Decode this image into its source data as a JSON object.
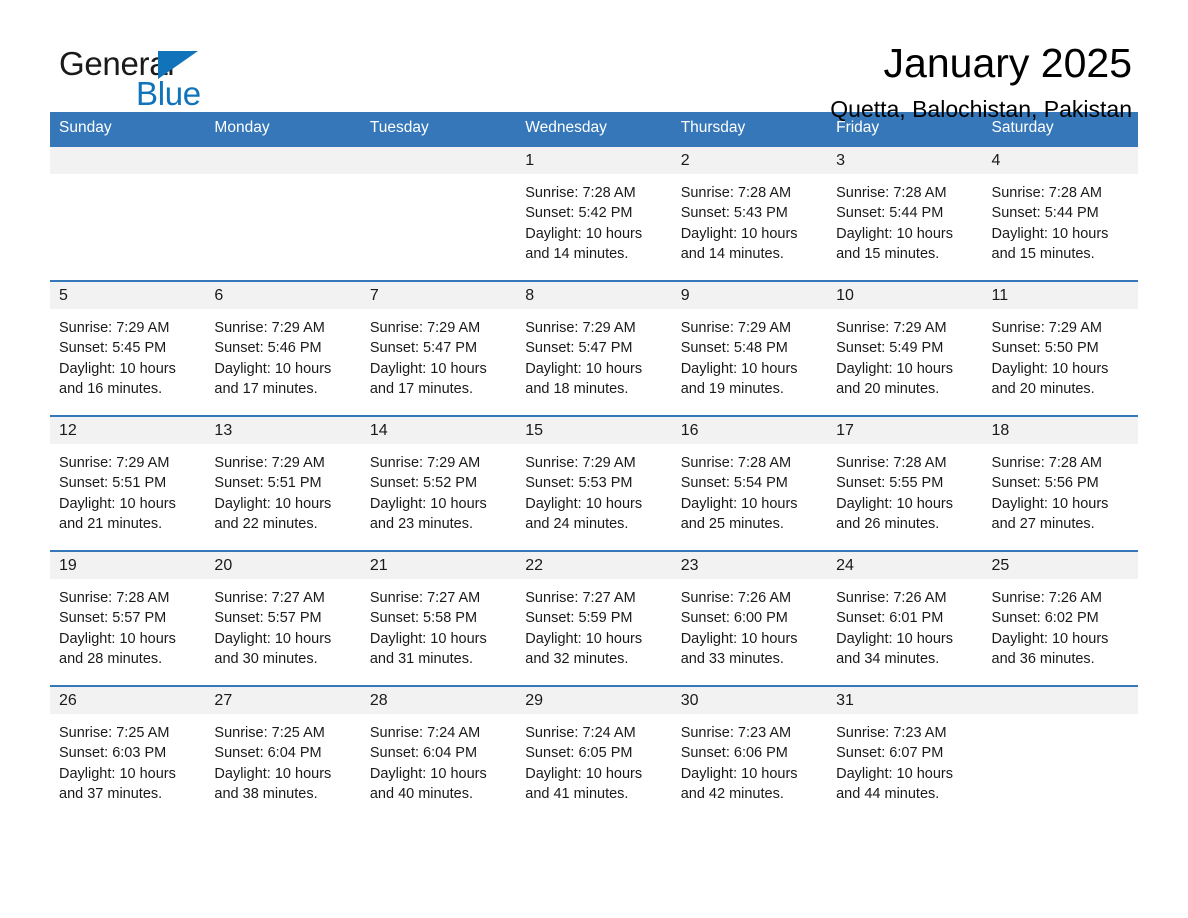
{
  "brand": {
    "name_part1": "General",
    "name_part2": "Blue",
    "logo_icon": "triangle-flag-icon"
  },
  "header": {
    "month_title": "January 2025",
    "location": "Quetta, Balochistan, Pakistan"
  },
  "colors": {
    "header_blue": "#3577b8",
    "brand_blue": "#1174ba",
    "daynum_band": "#f2f2f2",
    "text": "#1a1a1a"
  },
  "weekdays": [
    "Sunday",
    "Monday",
    "Tuesday",
    "Wednesday",
    "Thursday",
    "Friday",
    "Saturday"
  ],
  "weeks": [
    [
      {
        "day": "",
        "blank": true
      },
      {
        "day": "",
        "blank": true
      },
      {
        "day": "",
        "blank": true
      },
      {
        "day": "1",
        "sunrise": "Sunrise: 7:28 AM",
        "sunset": "Sunset: 5:42 PM",
        "daylight1": "Daylight: 10 hours",
        "daylight2": "and 14 minutes."
      },
      {
        "day": "2",
        "sunrise": "Sunrise: 7:28 AM",
        "sunset": "Sunset: 5:43 PM",
        "daylight1": "Daylight: 10 hours",
        "daylight2": "and 14 minutes."
      },
      {
        "day": "3",
        "sunrise": "Sunrise: 7:28 AM",
        "sunset": "Sunset: 5:44 PM",
        "daylight1": "Daylight: 10 hours",
        "daylight2": "and 15 minutes."
      },
      {
        "day": "4",
        "sunrise": "Sunrise: 7:28 AM",
        "sunset": "Sunset: 5:44 PM",
        "daylight1": "Daylight: 10 hours",
        "daylight2": "and 15 minutes."
      }
    ],
    [
      {
        "day": "5",
        "sunrise": "Sunrise: 7:29 AM",
        "sunset": "Sunset: 5:45 PM",
        "daylight1": "Daylight: 10 hours",
        "daylight2": "and 16 minutes."
      },
      {
        "day": "6",
        "sunrise": "Sunrise: 7:29 AM",
        "sunset": "Sunset: 5:46 PM",
        "daylight1": "Daylight: 10 hours",
        "daylight2": "and 17 minutes."
      },
      {
        "day": "7",
        "sunrise": "Sunrise: 7:29 AM",
        "sunset": "Sunset: 5:47 PM",
        "daylight1": "Daylight: 10 hours",
        "daylight2": "and 17 minutes."
      },
      {
        "day": "8",
        "sunrise": "Sunrise: 7:29 AM",
        "sunset": "Sunset: 5:47 PM",
        "daylight1": "Daylight: 10 hours",
        "daylight2": "and 18 minutes."
      },
      {
        "day": "9",
        "sunrise": "Sunrise: 7:29 AM",
        "sunset": "Sunset: 5:48 PM",
        "daylight1": "Daylight: 10 hours",
        "daylight2": "and 19 minutes."
      },
      {
        "day": "10",
        "sunrise": "Sunrise: 7:29 AM",
        "sunset": "Sunset: 5:49 PM",
        "daylight1": "Daylight: 10 hours",
        "daylight2": "and 20 minutes."
      },
      {
        "day": "11",
        "sunrise": "Sunrise: 7:29 AM",
        "sunset": "Sunset: 5:50 PM",
        "daylight1": "Daylight: 10 hours",
        "daylight2": "and 20 minutes."
      }
    ],
    [
      {
        "day": "12",
        "sunrise": "Sunrise: 7:29 AM",
        "sunset": "Sunset: 5:51 PM",
        "daylight1": "Daylight: 10 hours",
        "daylight2": "and 21 minutes."
      },
      {
        "day": "13",
        "sunrise": "Sunrise: 7:29 AM",
        "sunset": "Sunset: 5:51 PM",
        "daylight1": "Daylight: 10 hours",
        "daylight2": "and 22 minutes."
      },
      {
        "day": "14",
        "sunrise": "Sunrise: 7:29 AM",
        "sunset": "Sunset: 5:52 PM",
        "daylight1": "Daylight: 10 hours",
        "daylight2": "and 23 minutes."
      },
      {
        "day": "15",
        "sunrise": "Sunrise: 7:29 AM",
        "sunset": "Sunset: 5:53 PM",
        "daylight1": "Daylight: 10 hours",
        "daylight2": "and 24 minutes."
      },
      {
        "day": "16",
        "sunrise": "Sunrise: 7:28 AM",
        "sunset": "Sunset: 5:54 PM",
        "daylight1": "Daylight: 10 hours",
        "daylight2": "and 25 minutes."
      },
      {
        "day": "17",
        "sunrise": "Sunrise: 7:28 AM",
        "sunset": "Sunset: 5:55 PM",
        "daylight1": "Daylight: 10 hours",
        "daylight2": "and 26 minutes."
      },
      {
        "day": "18",
        "sunrise": "Sunrise: 7:28 AM",
        "sunset": "Sunset: 5:56 PM",
        "daylight1": "Daylight: 10 hours",
        "daylight2": "and 27 minutes."
      }
    ],
    [
      {
        "day": "19",
        "sunrise": "Sunrise: 7:28 AM",
        "sunset": "Sunset: 5:57 PM",
        "daylight1": "Daylight: 10 hours",
        "daylight2": "and 28 minutes."
      },
      {
        "day": "20",
        "sunrise": "Sunrise: 7:27 AM",
        "sunset": "Sunset: 5:57 PM",
        "daylight1": "Daylight: 10 hours",
        "daylight2": "and 30 minutes."
      },
      {
        "day": "21",
        "sunrise": "Sunrise: 7:27 AM",
        "sunset": "Sunset: 5:58 PM",
        "daylight1": "Daylight: 10 hours",
        "daylight2": "and 31 minutes."
      },
      {
        "day": "22",
        "sunrise": "Sunrise: 7:27 AM",
        "sunset": "Sunset: 5:59 PM",
        "daylight1": "Daylight: 10 hours",
        "daylight2": "and 32 minutes."
      },
      {
        "day": "23",
        "sunrise": "Sunrise: 7:26 AM",
        "sunset": "Sunset: 6:00 PM",
        "daylight1": "Daylight: 10 hours",
        "daylight2": "and 33 minutes."
      },
      {
        "day": "24",
        "sunrise": "Sunrise: 7:26 AM",
        "sunset": "Sunset: 6:01 PM",
        "daylight1": "Daylight: 10 hours",
        "daylight2": "and 34 minutes."
      },
      {
        "day": "25",
        "sunrise": "Sunrise: 7:26 AM",
        "sunset": "Sunset: 6:02 PM",
        "daylight1": "Daylight: 10 hours",
        "daylight2": "and 36 minutes."
      }
    ],
    [
      {
        "day": "26",
        "sunrise": "Sunrise: 7:25 AM",
        "sunset": "Sunset: 6:03 PM",
        "daylight1": "Daylight: 10 hours",
        "daylight2": "and 37 minutes."
      },
      {
        "day": "27",
        "sunrise": "Sunrise: 7:25 AM",
        "sunset": "Sunset: 6:04 PM",
        "daylight1": "Daylight: 10 hours",
        "daylight2": "and 38 minutes."
      },
      {
        "day": "28",
        "sunrise": "Sunrise: 7:24 AM",
        "sunset": "Sunset: 6:04 PM",
        "daylight1": "Daylight: 10 hours",
        "daylight2": "and 40 minutes."
      },
      {
        "day": "29",
        "sunrise": "Sunrise: 7:24 AM",
        "sunset": "Sunset: 6:05 PM",
        "daylight1": "Daylight: 10 hours",
        "daylight2": "and 41 minutes."
      },
      {
        "day": "30",
        "sunrise": "Sunrise: 7:23 AM",
        "sunset": "Sunset: 6:06 PM",
        "daylight1": "Daylight: 10 hours",
        "daylight2": "and 42 minutes."
      },
      {
        "day": "31",
        "sunrise": "Sunrise: 7:23 AM",
        "sunset": "Sunset: 6:07 PM",
        "daylight1": "Daylight: 10 hours",
        "daylight2": "and 44 minutes."
      },
      {
        "day": "",
        "blank": true
      }
    ]
  ]
}
